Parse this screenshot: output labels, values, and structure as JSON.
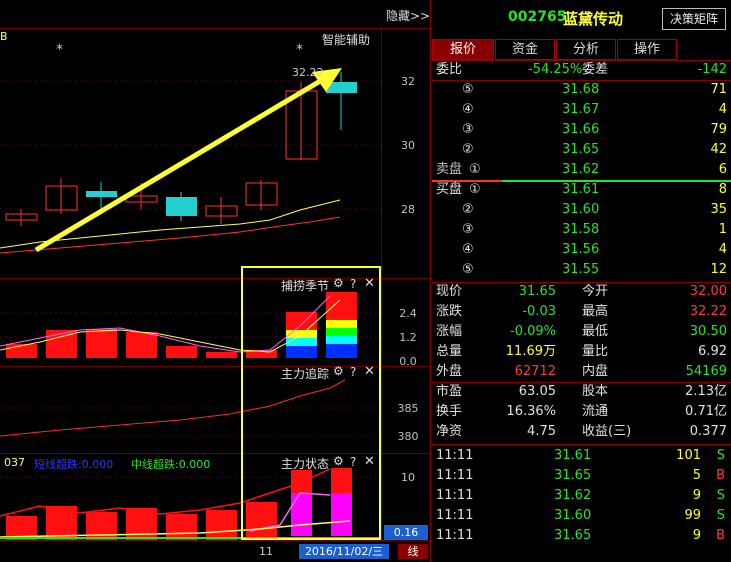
{
  "colors": {
    "up": "#ff2a2a",
    "down": "#22e622",
    "flat": "#e0e0e0",
    "grid": "#6b0000",
    "highlight": "#ffff33",
    "accent": "#22d0d0"
  },
  "toolbar": {
    "hide_label": "隐藏>>",
    "smart_assist": "智能辅助",
    "corner_mark": "B"
  },
  "main_chart": {
    "price_ticks": [
      "32",
      "30",
      "28"
    ],
    "top_price_label": "32.22",
    "stars": [
      "*",
      "*"
    ]
  },
  "indicator1": {
    "title": "捕捞季节",
    "ticks": [
      "2.4",
      "1.2",
      "0.0"
    ]
  },
  "indicator2": {
    "title": "主力追踪",
    "ticks": [
      "385",
      "380"
    ]
  },
  "indicator3": {
    "title": "主力状态",
    "ticks": [
      "10"
    ],
    "left_code": "037",
    "short_label": "短线超跌:0.000",
    "mid_label": "中线超跌:0.000",
    "value_box": "0.16"
  },
  "bottom_axis": {
    "tick": "11",
    "date_label": "2016/11/02/三",
    "line_tag": "线"
  },
  "stock": {
    "code": "002765",
    "name": "蓝黛传动",
    "decision_btn": "决策矩阵"
  },
  "tabs": [
    "报价",
    "资金",
    "分析",
    "操作"
  ],
  "order_book": {
    "webi_label": "委比",
    "webi_value": "-54.25%",
    "weicha_label": "委差",
    "weicha_value": "-142",
    "sell_label": "卖盘",
    "buy_label": "买盘",
    "sells": [
      {
        "level": "⑤",
        "price": "31.68",
        "vol": "71"
      },
      {
        "level": "④",
        "price": "31.67",
        "vol": "4"
      },
      {
        "level": "③",
        "price": "31.66",
        "vol": "79"
      },
      {
        "level": "②",
        "price": "31.65",
        "vol": "42"
      },
      {
        "level": "①",
        "price": "31.62",
        "vol": "6"
      }
    ],
    "buys": [
      {
        "level": "①",
        "price": "31.61",
        "vol": "8"
      },
      {
        "level": "②",
        "price": "31.60",
        "vol": "35"
      },
      {
        "level": "③",
        "price": "31.58",
        "vol": "1"
      },
      {
        "level": "④",
        "price": "31.56",
        "vol": "4"
      },
      {
        "level": "⑤",
        "price": "31.55",
        "vol": "12"
      }
    ]
  },
  "quote": [
    {
      "l1": "现价",
      "v1": "31.65",
      "c1": "green",
      "l2": "今开",
      "v2": "32.00",
      "c2": "red"
    },
    {
      "l1": "涨跌",
      "v1": "-0.03",
      "c1": "green",
      "l2": "最高",
      "v2": "32.22",
      "c2": "red"
    },
    {
      "l1": "涨幅",
      "v1": "-0.09%",
      "c1": "green",
      "l2": "最低",
      "v2": "30.50",
      "c2": "green"
    },
    {
      "l1": "总量",
      "v1": "11.69万",
      "c1": "yellow",
      "l2": "量比",
      "v2": "6.92",
      "c2": "white"
    },
    {
      "l1": "外盘",
      "v1": "62712",
      "c1": "red",
      "l2": "内盘",
      "v2": "54169",
      "c2": "green"
    }
  ],
  "fundamentals": [
    {
      "l1": "市盈",
      "v1": "63.05",
      "l2": "股本",
      "v2": "2.13亿"
    },
    {
      "l1": "换手",
      "v1": "16.36%",
      "l2": "流通",
      "v2": "0.71亿"
    },
    {
      "l1": "净资",
      "v1": "4.75",
      "l2": "收益(三)",
      "v2": "0.377"
    }
  ],
  "ticks_list": [
    {
      "time": "11:11",
      "price": "31.61",
      "vol": "101",
      "side": "S"
    },
    {
      "time": "11:11",
      "price": "31.65",
      "vol": "5",
      "side": "B"
    },
    {
      "time": "11:11",
      "price": "31.62",
      "vol": "9",
      "side": "S"
    },
    {
      "time": "11:11",
      "price": "31.60",
      "vol": "99",
      "side": "S"
    },
    {
      "time": "11:11",
      "price": "31.65",
      "vol": "9",
      "side": "B"
    }
  ]
}
